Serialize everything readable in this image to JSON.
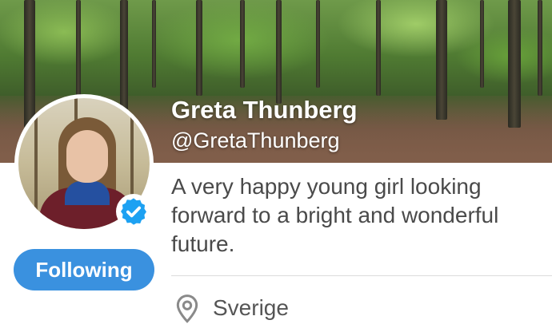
{
  "profile": {
    "name": "Greta Thunberg",
    "handle": "@GretaThunberg",
    "bio": "A very happy young girl looking forward to a bright and wonderful future.",
    "location": "Sverige",
    "verified": true
  },
  "actions": {
    "follow_label": "Following"
  },
  "icons": {
    "verified": "verified-badge-icon",
    "location": "location-pin-icon"
  },
  "colors": {
    "accent": "#3a91df",
    "verified_badge": "#1da1f2",
    "bio_text": "#4a4a4a",
    "location_text": "#555555"
  }
}
